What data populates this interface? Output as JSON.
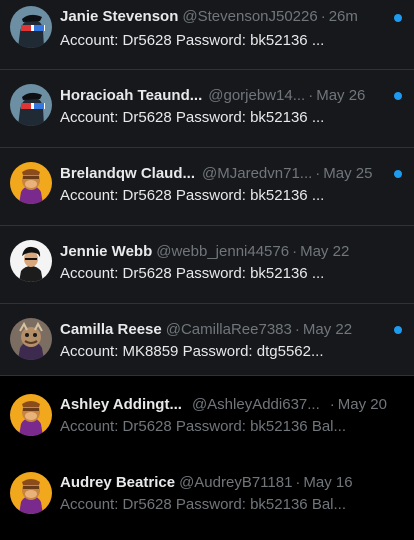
{
  "colors": {
    "accent": "#1d9bf0",
    "unread_bg": "#16181c",
    "read_bg": "#000000",
    "name_text": "#e7e9ea",
    "muted_text": "#71767b"
  },
  "conversations": [
    {
      "name": "Janie Stevenson",
      "handle": "@StevensonJ50226",
      "date": "26m",
      "preview": "Account: Dr5628 Password: bk52136 ...",
      "unread": true,
      "avatar": "glasses-avatar-icon"
    },
    {
      "name": "Horacioah Teaund...",
      "handle": "@gorjebw14...",
      "date": "May 26",
      "preview": "Account: Dr5628 Password: bk52136 ...",
      "unread": true,
      "avatar": "glasses-avatar-icon"
    },
    {
      "name": "Brelandqw Claud...",
      "handle": "@MJaredvn71...",
      "date": "May 25",
      "preview": "Account: Dr5628 Password: bk52136 ...",
      "unread": true,
      "avatar": "ape-avatar-icon"
    },
    {
      "name": "Jennie Webb",
      "handle": "@webb_jenni44576",
      "date": "May 22",
      "preview": "Account: Dr5628 Password: bk52136 ...",
      "unread": true,
      "avatar": "cartoon-person-avatar-icon"
    },
    {
      "name": "Camilla Reese",
      "handle": "@CamillaRee7383",
      "date": "May 22",
      "preview": "Account: MK8859 Password: dtg5562...",
      "unread": true,
      "avatar": "monster-avatar-icon"
    },
    {
      "name": "Ashley Addingt...",
      "handle": "@AshleyAddi637...",
      "date": "May 20",
      "preview": "Account: Dr5628 Password: bk52136 Bal...",
      "unread": false,
      "avatar": "ape-avatar-icon"
    },
    {
      "name": "Audrey Beatrice",
      "handle": "@AudreyB71181",
      "date": "May 16",
      "preview": "Account: Dr5628 Password: bk52136 Bal...",
      "unread": false,
      "avatar": "ape-avatar-icon"
    }
  ],
  "separator": "·"
}
